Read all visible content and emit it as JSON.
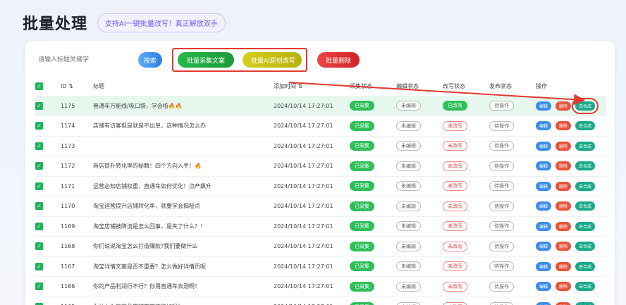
{
  "header": {
    "title": "批量处理",
    "badge": "支持AI一键批量改写！真正解放双手"
  },
  "toolbar": {
    "search_placeholder": "请输入标题关键字",
    "search_label": "搜索",
    "batch_collect_label": "批量采集文案",
    "batch_ai_label": "批量AI原创改写",
    "batch_delete_label": "批量删除"
  },
  "table": {
    "columns": [
      "",
      "ID ⇅",
      "标题",
      "",
      "添加时间 ⇅",
      "采集状态",
      "编辑状态",
      "改写状态",
      "发布状态",
      "操作"
    ],
    "ops": {
      "edit": "编辑",
      "delete": "删除",
      "compose": "去合成"
    },
    "rows": [
      {
        "id": "1175",
        "title": "普通车万能线/吸口袋，学会啦🔥🔥",
        "time": "2024/10/14 17:27:01",
        "collect": "已采集",
        "edit": "未编辑",
        "rewrite": "已改写",
        "publish": "待操作"
      },
      {
        "id": "1174",
        "title": "店铺有访客但是就是不出单，这种情况怎么办",
        "time": "2024/10/14 17:27:01",
        "collect": "已采集",
        "edit": "未编辑",
        "rewrite": "未改写",
        "publish": "待操作"
      },
      {
        "id": "1173",
        "title": "",
        "time": "2024/10/14 17:27:01",
        "collect": "已采集",
        "edit": "未编辑",
        "rewrite": "未改写",
        "publish": "待操作"
      },
      {
        "id": "1172",
        "title": "新店提升转化率的秘籍！四个方向入手！🔥",
        "time": "2024/10/14 17:27:01",
        "collect": "已采集",
        "edit": "未编辑",
        "rewrite": "未改写",
        "publish": "待操作"
      },
      {
        "id": "1171",
        "title": "运营必知店铺权重，直通车如何优化！点产飙升",
        "time": "2024/10/14 17:27:01",
        "collect": "已采集",
        "edit": "未编辑",
        "rewrite": "未改写",
        "publish": "待操作"
      },
      {
        "id": "1170",
        "title": "淘宝运营提升店铺转化率，就要学会揭秘点",
        "time": "2024/10/14 17:27:01",
        "collect": "已采集",
        "edit": "未编辑",
        "rewrite": "未改写",
        "publish": "待操作"
      },
      {
        "id": "1169",
        "title": "淘宝店铺被降流是怎么回事，是失了什么？！",
        "time": "2024/10/14 17:27:01",
        "collect": "已采集",
        "edit": "未编辑",
        "rewrite": "未改写",
        "publish": "待操作"
      },
      {
        "id": "1168",
        "title": "你们说说淘宝怎么打造爆款?我们要做什么",
        "time": "2024/10/14 17:27:01",
        "collect": "已采集",
        "edit": "未编辑",
        "rewrite": "未改写",
        "publish": "待操作"
      },
      {
        "id": "1167",
        "title": "淘宝详情文案是否不重要？怎么做好详情页呢",
        "time": "2024/10/14 17:27:01",
        "collect": "已采集",
        "edit": "未编辑",
        "rewrite": "未改写",
        "publish": "待操作"
      },
      {
        "id": "1166",
        "title": "你的产品利润行不行？你用直通车去测啊！",
        "time": "2024/10/14 17:27:01",
        "collect": "已采集",
        "edit": "未编辑",
        "rewrite": "未改写",
        "publish": "待操作"
      },
      {
        "id": "1165",
        "title": "为什么你的商品店铺在实不能好吗！",
        "time": "2024/10/14 17:27:01",
        "collect": "已采集",
        "edit": "未编辑",
        "rewrite": "未改写",
        "publish": "待操作"
      }
    ]
  },
  "colors": {
    "accent": "#1fb35a",
    "highlight": "#e23b2f"
  }
}
